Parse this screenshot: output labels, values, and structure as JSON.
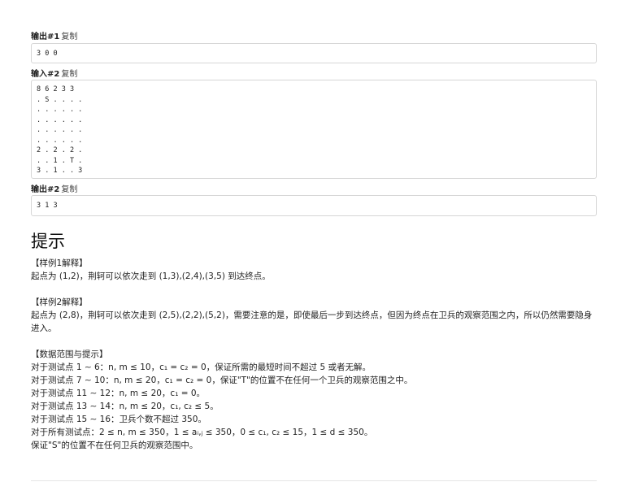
{
  "copy_label": "复制",
  "outputs1": {
    "label": "输出#1",
    "content": "3 0 0"
  },
  "inputs2": {
    "label": "输入#2",
    "content": "8 6 2 3 3\n. S . . . .\n. . . . . .\n. . . . . .\n. . . . . .\n. . . . . .\n2 . 2 . 2 .\n. . 1 . T .\n3 . 1 . . 3"
  },
  "outputs2": {
    "label": "输出#2",
    "content": "3 1 3"
  },
  "hint": {
    "title": "提示",
    "ex1_heading": "【样例1解释】",
    "ex1_text": "起点为 (1,2)，荆轲可以依次走到 (1,3),(2,4),(3,5) 到达终点。",
    "ex2_heading": "【样例2解释】",
    "ex2_text": "起点为 (2,8)，荆轲可以依次走到 (2,5),(2,2),(5,2)，需要注意的是，即使最后一步到达终点，但因为终点在卫兵的观察范围之内，所以仍然需要隐身进入。",
    "range_heading": "【数据范围与提示】",
    "range_lines": [
      "对于测试点 1 ∼ 6：n, m ≤ 10，c₁ = c₂ = 0，保证所需的最短时间不超过 5 或者无解。",
      "对于测试点 7 ∼ 10：n, m ≤ 20，c₁ = c₂ = 0，保证\"T\"的位置不在任何一个卫兵的观察范围之中。",
      "对于测试点 11 ∼ 12：n, m ≤ 20，c₁ = 0。",
      "对于测试点 13 ∼ 14：n, m ≤ 20，c₁, c₂ ≤ 5。",
      "对于测试点 15 ∼ 16：卫兵个数不超过 350。",
      "对于所有测试点：2 ≤ n, m ≤ 350，1 ≤ aᵢ,ⱼ ≤ 350，0 ≤ c₁, c₂ ≤ 15，1 ≤ d ≤ 350。",
      "保证\"S\"的位置不在任何卫兵的观察范围中。"
    ]
  }
}
